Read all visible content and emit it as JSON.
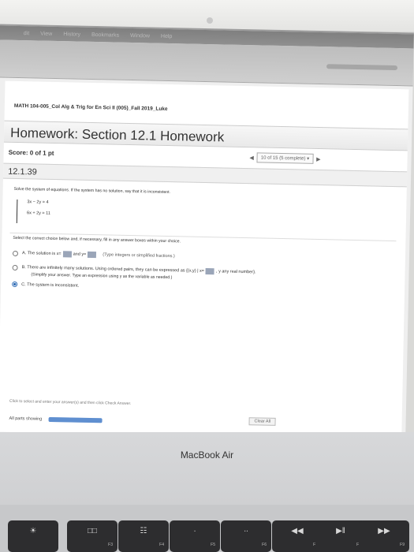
{
  "menubar": {
    "items": [
      "dit",
      "View",
      "History",
      "Bookmarks",
      "Window",
      "Help"
    ]
  },
  "course": {
    "title": "MATH 104-005_Col Alg & Trig for En Sci II (005)_Fall 2019_Luke"
  },
  "homework": {
    "title": "Homework: Section 12.1 Homework",
    "score": "Score: 0 of 1 pt",
    "pager_status": "10 of 15 (5 complete)"
  },
  "question": {
    "number": "12.1.39",
    "instructions": "Solve the system of equations. If the system has no solution, say that it is inconsistent.",
    "equations": [
      "3x − 2y = 4",
      "6x + 2y = 11"
    ],
    "select_prompt": "Select the correct choice below and, if necessary, fill in any answer boxes within your choice.",
    "choices": [
      {
        "letter": "A.",
        "text_before": "The solution is x=",
        "text_mid": "and y=",
        "hint": "(Type integers or simplified fractions.)",
        "selected": false
      },
      {
        "letter": "B.",
        "text_before": "There are infinitely many solutions. Using ordered pairs, they can be expressed as {(x,y) | x=",
        "text_after": ", y any real number}.",
        "subline": "(Simplify your answer. Type an expression using y as the variable as needed.)",
        "selected": false
      },
      {
        "letter": "C.",
        "text_before": "The system is inconsistent.",
        "selected": true
      }
    ]
  },
  "footer": {
    "hint": "Click to select and enter your answer(s) and then click Check Answer.",
    "parts_label": "All parts showing",
    "parts_progress": 1.0,
    "clear_all": "Clear All"
  },
  "device": {
    "brand": "MacBook Air",
    "fkeys": [
      {
        "glyph": "☀",
        "label": ""
      },
      {
        "glyph": "□□",
        "label": "F3"
      },
      {
        "glyph": "☷",
        "label": "F4"
      },
      {
        "glyph": "∙",
        "label": "F5"
      },
      {
        "glyph": "∙∙",
        "label": "F6"
      },
      {
        "glyph": "◀◀",
        "label": "F7"
      },
      {
        "glyph": "▶‖",
        "label": "F8"
      },
      {
        "glyph": "▶▶",
        "label": "F9"
      }
    ]
  },
  "colors": {
    "selected_radio": "#2e6bb5",
    "answer_box": "#9aa5b8",
    "progress_fill": "#5f8fd0",
    "dock": "#3b4451"
  }
}
